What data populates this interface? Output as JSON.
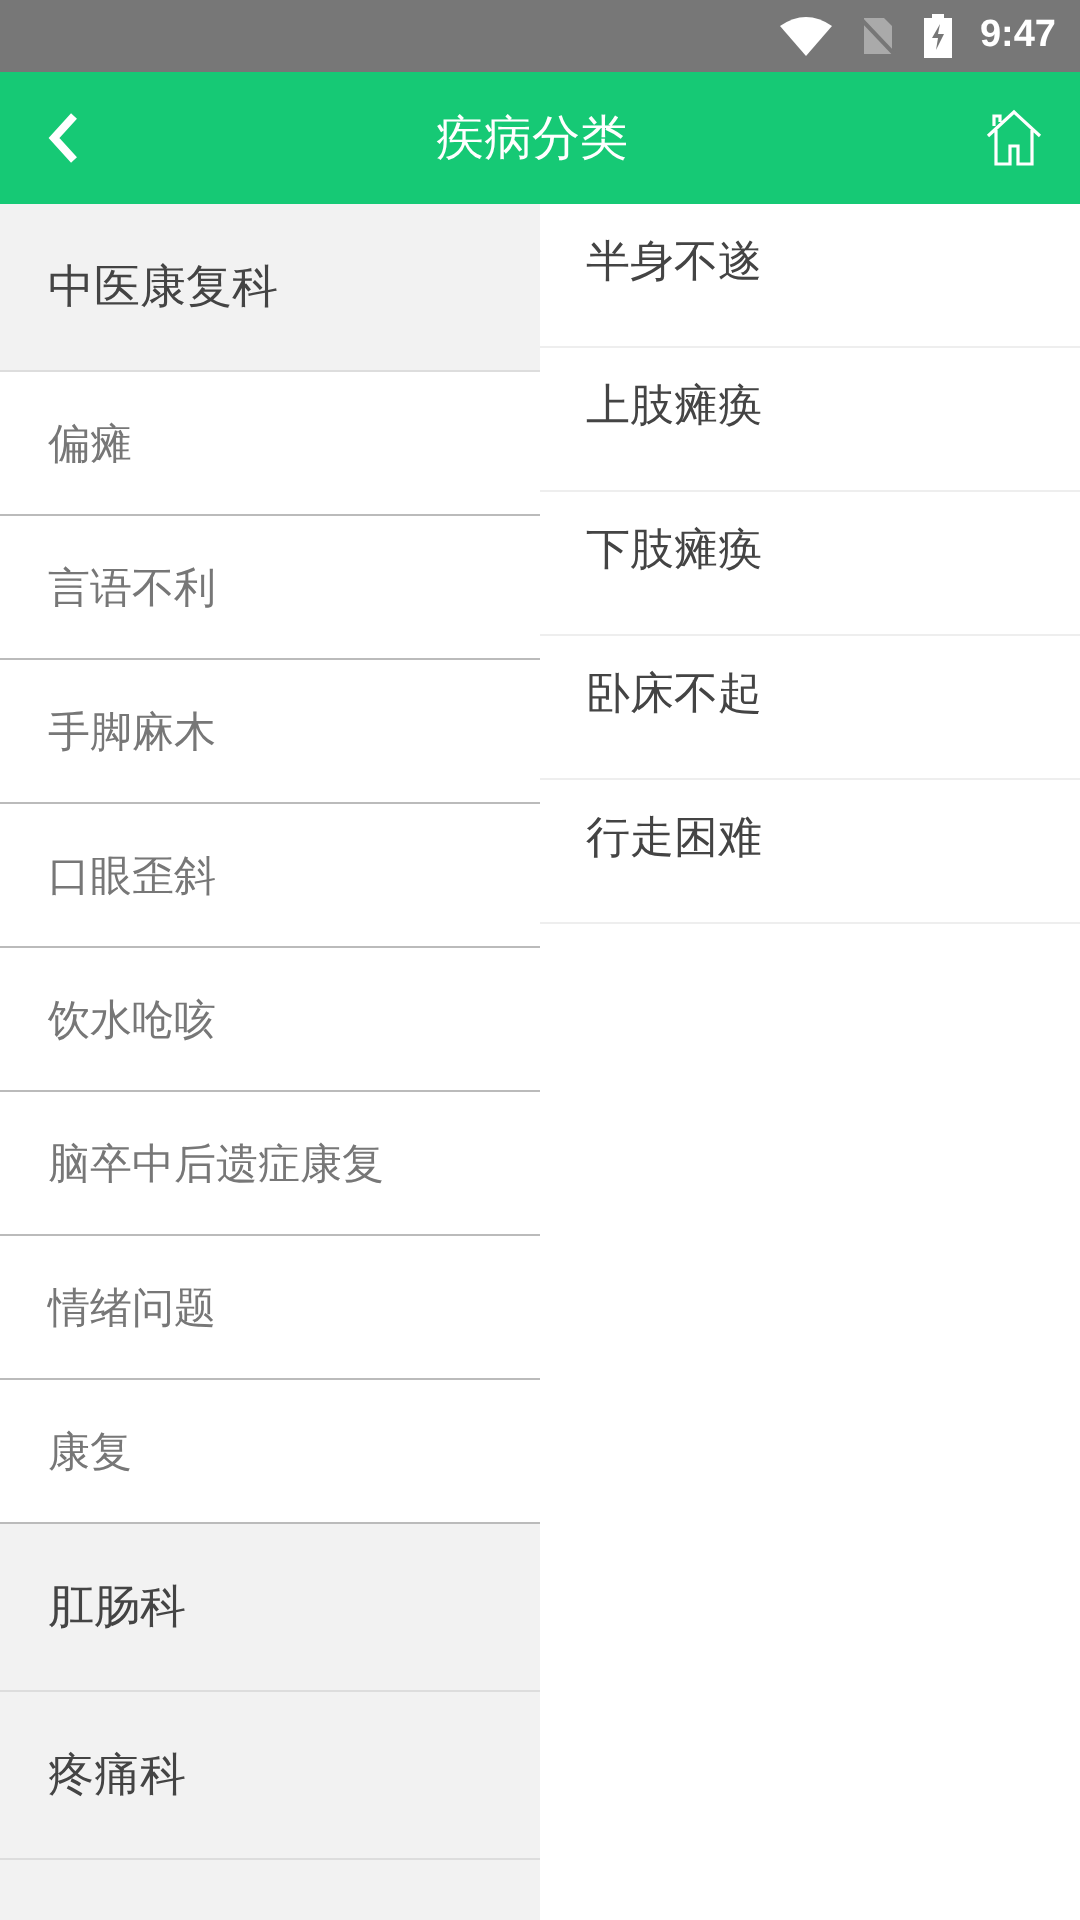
{
  "status_bar": {
    "time": "9:47"
  },
  "header": {
    "title": "疾病分类"
  },
  "categories": [
    {
      "label": "中医康复科",
      "children": [
        {
          "label": "偏瘫"
        },
        {
          "label": "言语不利"
        },
        {
          "label": "手脚麻木"
        },
        {
          "label": "口眼歪斜"
        },
        {
          "label": "饮水呛咳"
        },
        {
          "label": "脑卒中后遗症康复"
        },
        {
          "label": "情绪问题"
        },
        {
          "label": "康复"
        }
      ]
    },
    {
      "label": "肛肠科"
    },
    {
      "label": "疼痛科"
    }
  ],
  "diseases": [
    {
      "label": "半身不遂"
    },
    {
      "label": "上肢瘫痪"
    },
    {
      "label": "下肢瘫痪"
    },
    {
      "label": "卧床不起"
    },
    {
      "label": "行走困难"
    }
  ]
}
